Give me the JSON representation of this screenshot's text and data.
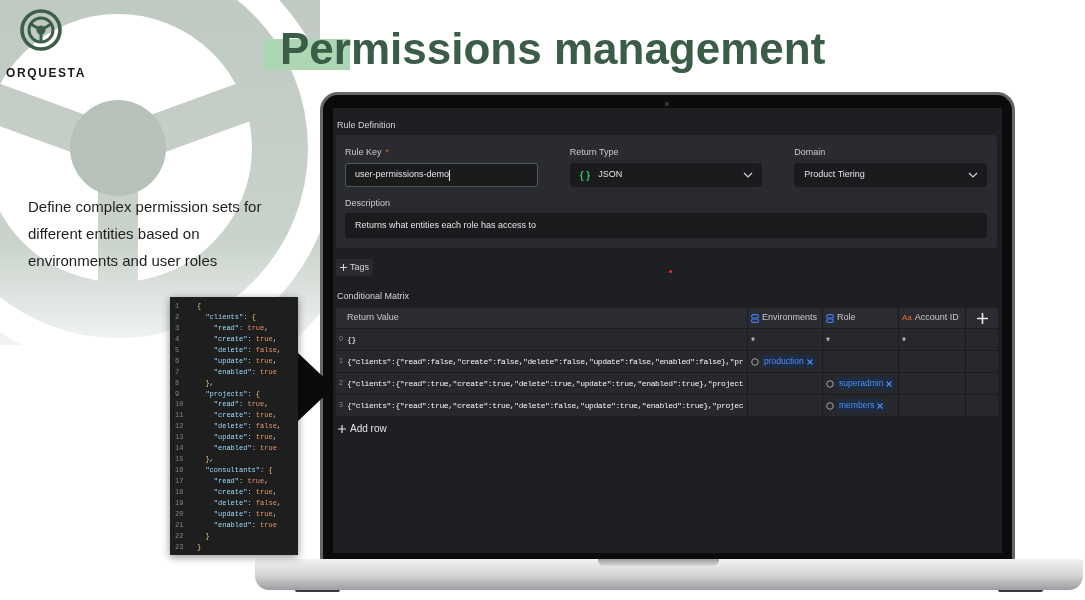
{
  "brand": {
    "name": "ORQUESTA"
  },
  "headline": {
    "text": "Permissions management"
  },
  "intro": "Define complex permission sets for different entities based on environments and user roles",
  "code_sample": {
    "lines": [
      {
        "number": "1",
        "code": "{"
      },
      {
        "number": "2",
        "code": "  \"clients\": {"
      },
      {
        "number": "3",
        "code": "    \"read\": true,"
      },
      {
        "number": "4",
        "code": "    \"create\": true,"
      },
      {
        "number": "5",
        "code": "    \"delete\": false,"
      },
      {
        "number": "6",
        "code": "    \"update\": true,"
      },
      {
        "number": "7",
        "code": "    \"enabled\": true"
      },
      {
        "number": "8",
        "code": "  },"
      },
      {
        "number": "9",
        "code": "  \"projects\": {"
      },
      {
        "number": "10",
        "code": "    \"read\": true,"
      },
      {
        "number": "11",
        "code": "    \"create\": true,"
      },
      {
        "number": "12",
        "code": "    \"delete\": false,"
      },
      {
        "number": "13",
        "code": "    \"update\": true,"
      },
      {
        "number": "14",
        "code": "    \"enabled\": true"
      },
      {
        "number": "15",
        "code": "  },"
      },
      {
        "number": "16",
        "code": "  \"consultants\": {"
      },
      {
        "number": "17",
        "code": "    \"read\": true,"
      },
      {
        "number": "18",
        "code": "    \"create\": true,"
      },
      {
        "number": "19",
        "code": "    \"delete\": false,"
      },
      {
        "number": "20",
        "code": "    \"update\": true,"
      },
      {
        "number": "21",
        "code": "    \"enabled\": true"
      },
      {
        "number": "22",
        "code": "  }"
      },
      {
        "number": "23",
        "code": "}"
      }
    ]
  },
  "app": {
    "rule_definition": {
      "heading": "Rule Definition",
      "fields": [
        {
          "kind": "text",
          "label": "Rule Key",
          "required_mark": "*",
          "value": "user-permissions-demo",
          "focused": true
        },
        {
          "kind": "select",
          "label": "Return Type",
          "icon": "{ }",
          "value": "JSON",
          "focused": false
        },
        {
          "kind": "select",
          "label": "Domain",
          "value": "Product Tiering",
          "focused": false
        }
      ],
      "description": {
        "label": "Description",
        "value": "Returns what entities each role has access to",
        "focused": false
      }
    },
    "tags_button": {
      "label": "Tags"
    },
    "matrix": {
      "heading": "Conditional Matrix",
      "columns": [
        {
          "kind": "value",
          "label": "Return Value"
        },
        {
          "kind": "list",
          "label": "Environments"
        },
        {
          "kind": "list",
          "label": "Role"
        },
        {
          "kind": "text",
          "label": "Account ID",
          "icon": "Aa"
        }
      ],
      "rows": [
        {
          "index": "0",
          "cells": [
            {
              "kind": "value",
              "text": "{}"
            },
            {
              "kind": "any",
              "text": "*"
            },
            {
              "kind": "any",
              "text": "*"
            },
            {
              "kind": "any",
              "text": "*"
            }
          ]
        },
        {
          "index": "1",
          "cells": [
            {
              "kind": "value",
              "text": "{\"clients\":{\"read\":false,\"create\":false,\"delete\":false,\"update\":false,\"enabled\":false},\"pr"
            },
            {
              "kind": "tags",
              "tags": [
                "production"
              ]
            },
            {
              "kind": "empty"
            },
            {
              "kind": "empty"
            }
          ]
        },
        {
          "index": "2",
          "cells": [
            {
              "kind": "value",
              "text": "{\"clients\":{\"read\":true,\"create\":true,\"delete\":true,\"update\":true,\"enabled\":true},\"project"
            },
            {
              "kind": "empty"
            },
            {
              "kind": "tags",
              "tags": [
                "superadmin"
              ]
            },
            {
              "kind": "empty"
            }
          ]
        },
        {
          "index": "3",
          "cells": [
            {
              "kind": "value",
              "text": "{\"clients\":{\"read\":true,\"create\":true,\"delete\":false,\"update\":true,\"enabled\":true},\"projec"
            },
            {
              "kind": "empty"
            },
            {
              "kind": "tags",
              "tags": [
                "members"
              ]
            },
            {
              "kind": "empty"
            }
          ]
        }
      ],
      "add_row": {
        "label": "Add row"
      }
    }
  }
}
